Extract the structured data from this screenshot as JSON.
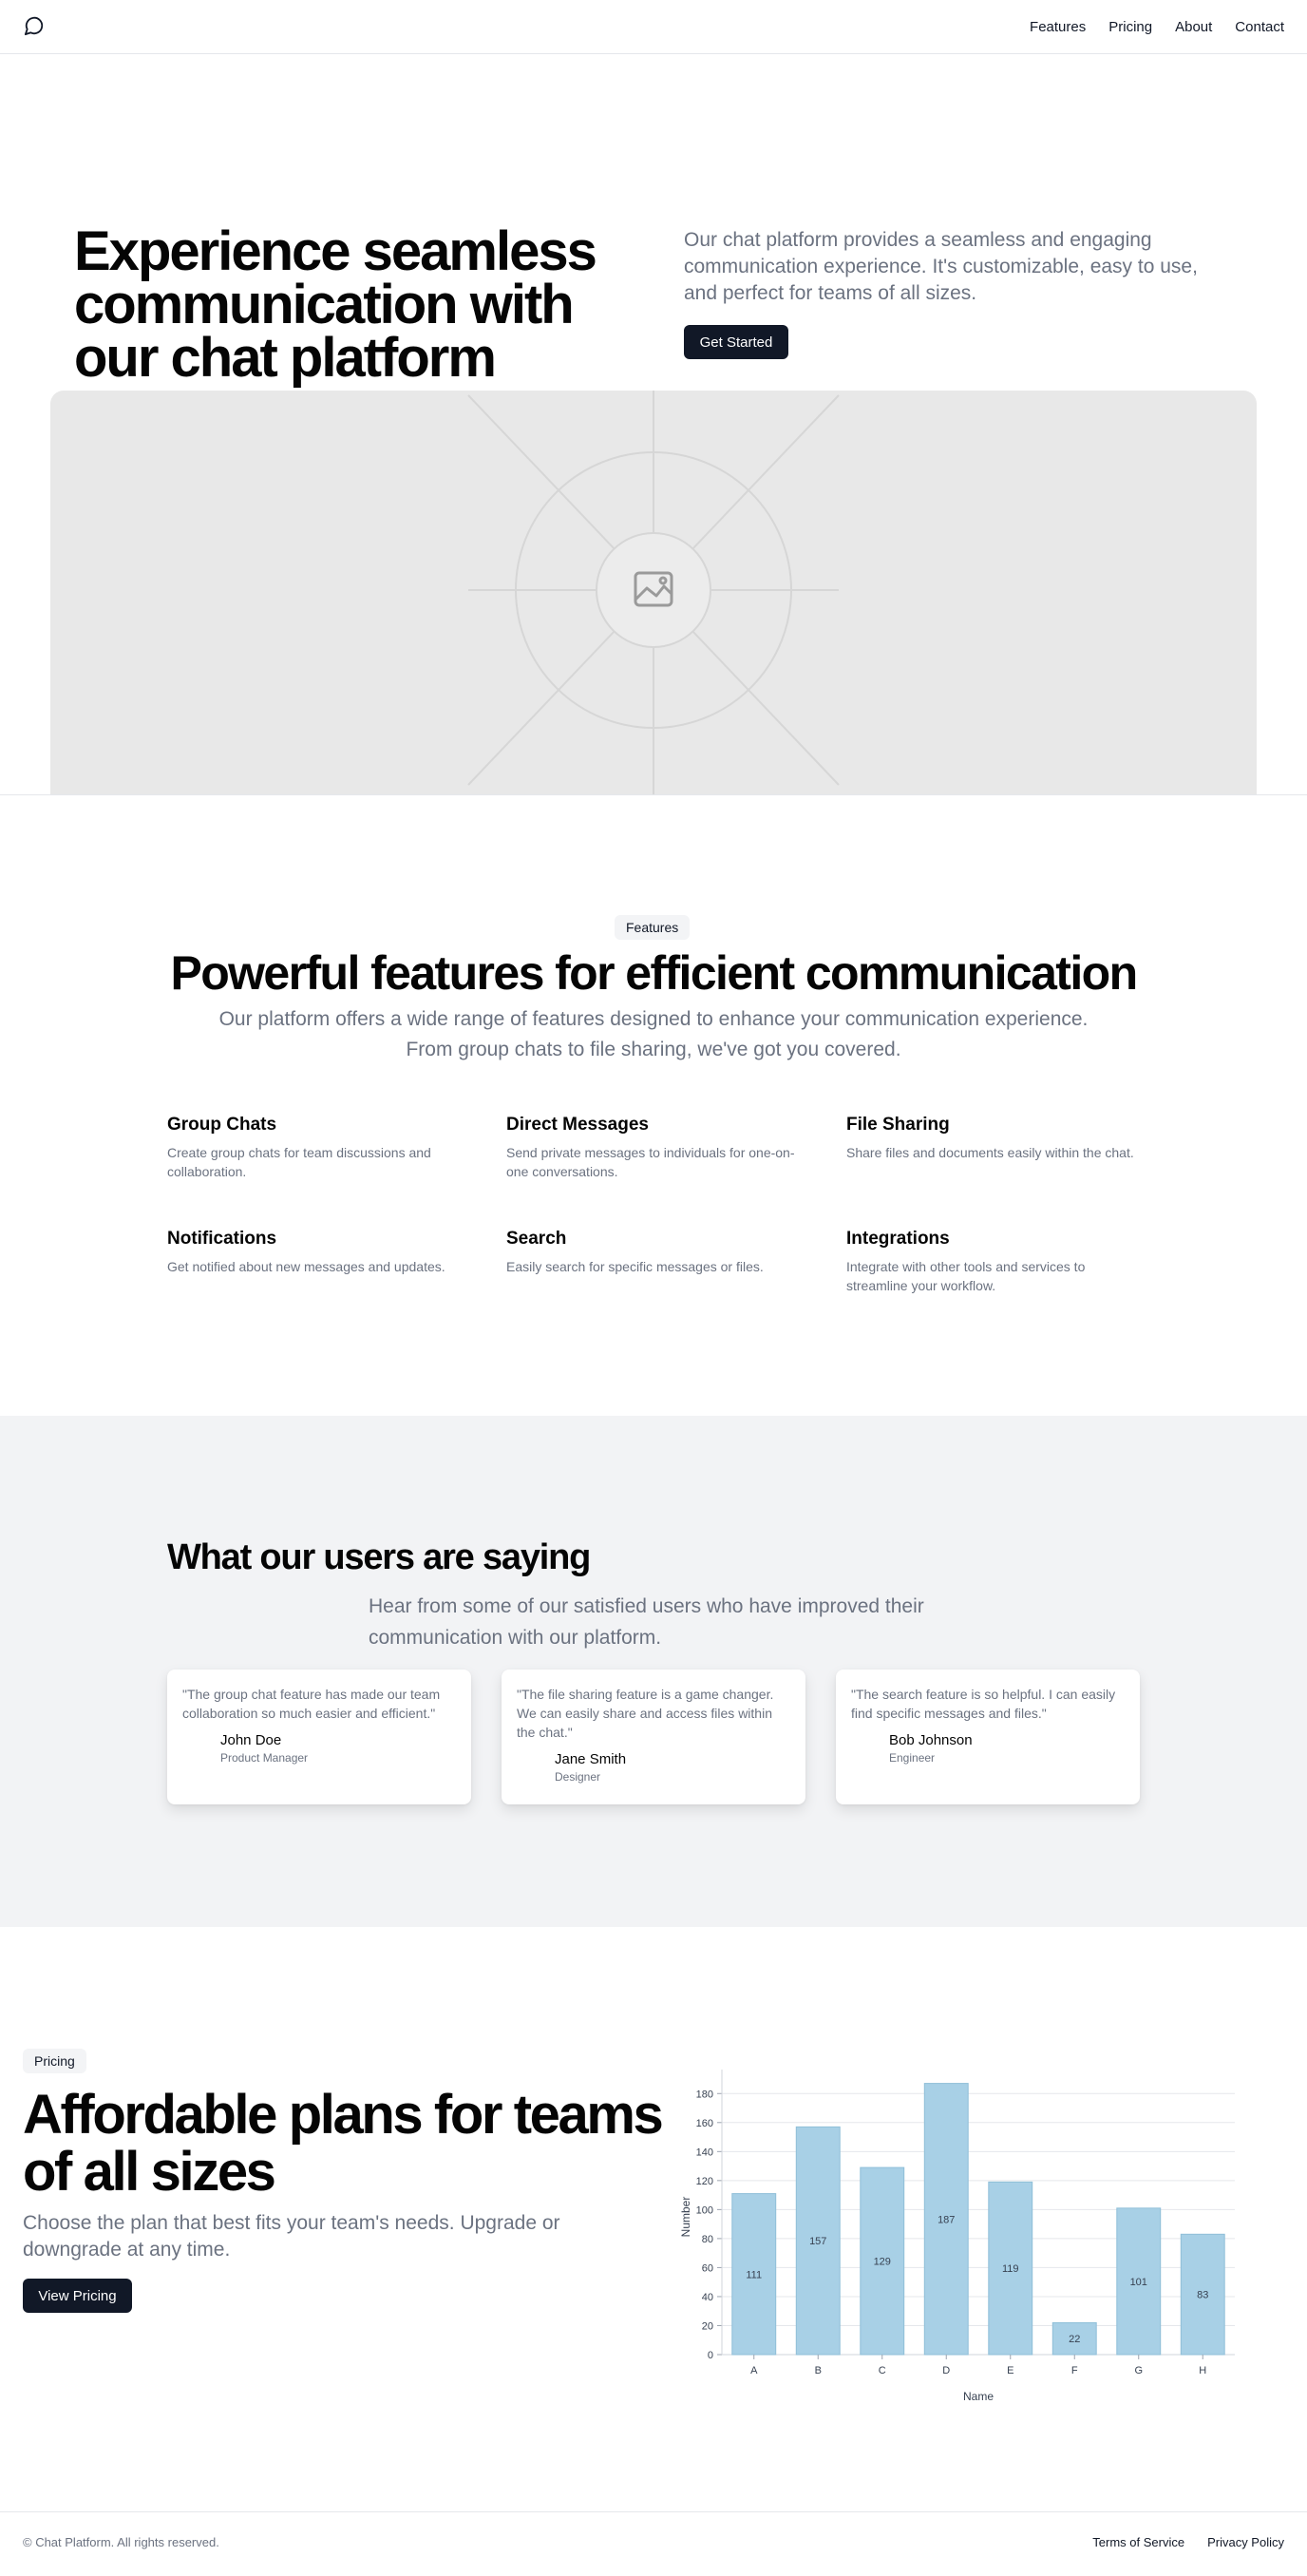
{
  "header": {
    "logo_icon": "message-circle-icon",
    "nav": [
      "Features",
      "Pricing",
      "About",
      "Contact"
    ]
  },
  "hero": {
    "title": "Experience seamless communication with our chat platform",
    "text": "Our chat platform provides a seamless and engaging communication experience. It's customizable, easy to use, and perfect for teams of all sizes.",
    "cta": "Get Started",
    "image_icon": "image-placeholder-icon"
  },
  "features": {
    "badge": "Features",
    "title": "Powerful features for efficient communication",
    "subtitle": "Our platform offers a wide range of features designed to enhance your communication experience. From group chats to file sharing, we've got you covered.",
    "items": [
      {
        "title": "Group Chats",
        "text": "Create group chats for team discussions and collaboration."
      },
      {
        "title": "Direct Messages",
        "text": "Send private messages to individuals for one-on-one conversations."
      },
      {
        "title": "File Sharing",
        "text": "Share files and documents easily within the chat."
      },
      {
        "title": "Notifications",
        "text": "Get notified about new messages and updates."
      },
      {
        "title": "Search",
        "text": "Easily search for specific messages or files."
      },
      {
        "title": "Integrations",
        "text": "Integrate with other tools and services to streamline your workflow."
      }
    ]
  },
  "testimonials": {
    "title": "What our users are saying",
    "subtitle": "Hear from some of our satisfied users who have improved their communication with our platform.",
    "items": [
      {
        "quote": "\"The group chat feature has made our team collaboration so much easier and efficient.\"",
        "name": "John Doe",
        "role": "Product Manager"
      },
      {
        "quote": "\"The file sharing feature is a game changer. We can easily share and access files within the chat.\"",
        "name": "Jane Smith",
        "role": "Designer"
      },
      {
        "quote": "\"The search feature is so helpful. I can easily find specific messages and files.\"",
        "name": "Bob Johnson",
        "role": "Engineer"
      }
    ]
  },
  "pricing": {
    "badge": "Pricing",
    "title": "Affordable plans for teams of all sizes",
    "text": "Choose the plan that best fits your team's needs. Upgrade or downgrade at any time.",
    "cta": "View Pricing"
  },
  "chart_data": {
    "type": "bar",
    "categories": [
      "A",
      "B",
      "C",
      "D",
      "E",
      "F",
      "G",
      "H"
    ],
    "values": [
      111,
      157,
      129,
      187,
      119,
      22,
      101,
      83
    ],
    "title": "",
    "xlabel": "Name",
    "ylabel": "Number",
    "ylim": [
      0,
      190
    ],
    "yticks": [
      0,
      20,
      40,
      60,
      80,
      100,
      120,
      140,
      160,
      180
    ],
    "grid": true,
    "bar_color": "#a8d0e6",
    "data_labels": true
  },
  "footer": {
    "copyright": "© Chat Platform. All rights reserved.",
    "links": [
      "Terms of Service",
      "Privacy Policy"
    ]
  },
  "colors": {
    "primary_dark": "#111827",
    "muted_text": "#6b7280",
    "section_gray": "#f2f3f5",
    "image_placeholder": "#e8e8e8"
  }
}
